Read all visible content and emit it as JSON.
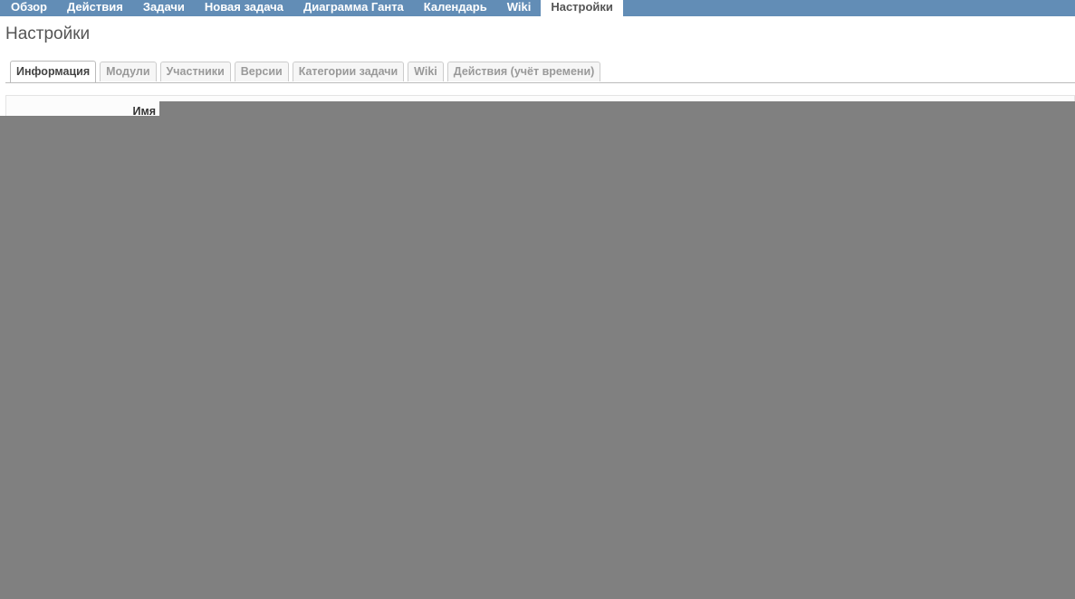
{
  "main_menu": {
    "items": [
      {
        "label": "Обзор"
      },
      {
        "label": "Действия"
      },
      {
        "label": "Задачи"
      },
      {
        "label": "Новая задача"
      },
      {
        "label": "Диаграмма Ганта"
      },
      {
        "label": "Календарь"
      },
      {
        "label": "Wiki"
      },
      {
        "label": "Настройки",
        "selected": true
      }
    ],
    "color": "#628db6"
  },
  "page": {
    "title": "Настройки"
  },
  "tabs": [
    {
      "label": "Информация",
      "selected": true
    },
    {
      "label": "Модули"
    },
    {
      "label": "Участники"
    },
    {
      "label": "Версии"
    },
    {
      "label": "Категории задачи"
    },
    {
      "label": "Wiki"
    },
    {
      "label": "Действия (учёт времени)"
    }
  ],
  "form": {
    "name_label": "Имя"
  },
  "colors": {
    "redaction": "#808080",
    "menu_background": "#628db6"
  }
}
